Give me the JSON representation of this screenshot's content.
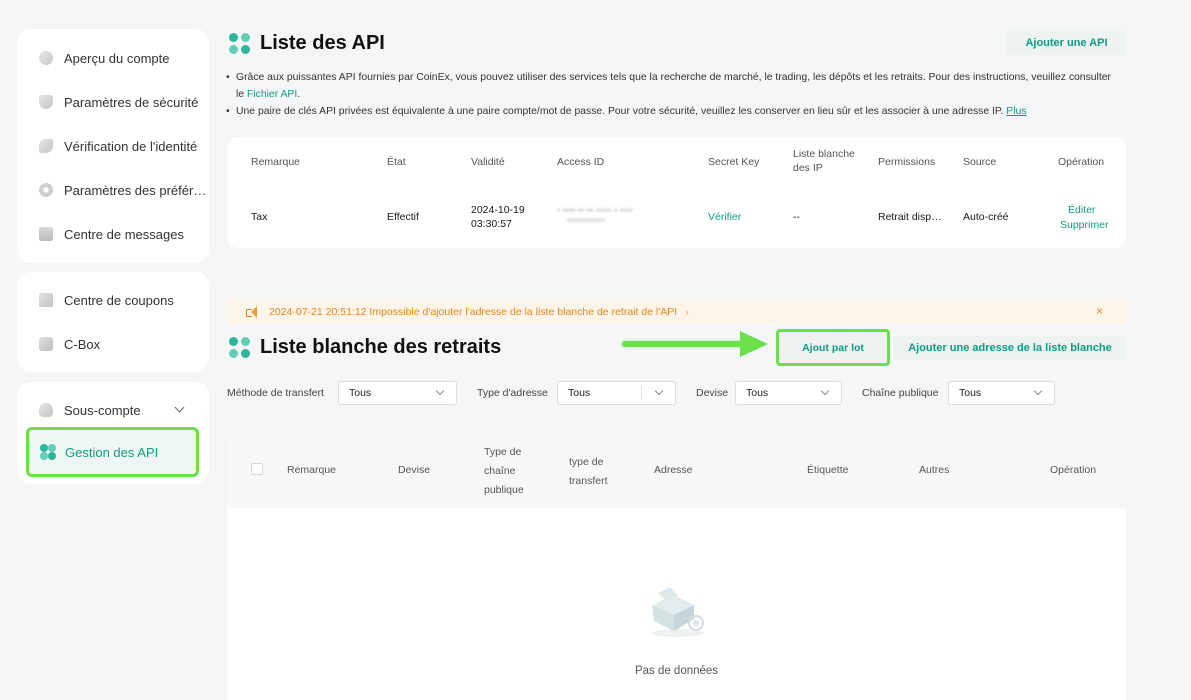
{
  "sidebar": {
    "group1": [
      {
        "label": "Aperçu du compte",
        "icon": "pie-chart-icon"
      },
      {
        "label": "Paramètres de sécurité",
        "icon": "shield-icon"
      },
      {
        "label": "Vérification de l'identité",
        "icon": "id-leaf-icon"
      },
      {
        "label": "Paramètres des préfér…",
        "icon": "gear-icon"
      },
      {
        "label": "Centre de messages",
        "icon": "message-icon"
      }
    ],
    "group2": [
      {
        "label": "Centre de coupons",
        "icon": "coupon-icon"
      },
      {
        "label": "C-Box",
        "icon": "box-icon"
      }
    ],
    "group3": [
      {
        "label": "Sous-compte",
        "icon": "sub-account-icon"
      },
      {
        "label": "Gestion des API",
        "icon": "api-icon"
      }
    ]
  },
  "api_list": {
    "title": "Liste des API",
    "add_button": "Ajouter une API",
    "bullet1_text": "Grâce aux puissantes API fournies par CoinEx, vous pouvez utiliser des services tels que la recherche de marché, le trading, les dépôts et les retraits. Pour des instructions, veuillez consulter le",
    "bullet1_link": "Fichier API",
    "bullet1_end": ".",
    "bullet2_text": "Une paire de clés API privées est équivalente à une paire compte/mot de passe. Pour votre sécurité, veuillez les conserver en lieu sûr et les associer à une adresse IP.",
    "bullet2_link": "Plus",
    "columns": {
      "remark": "Remarque",
      "state": "État",
      "validity": "Validité",
      "access_id": "Access ID",
      "secret_key": "Secret Key",
      "whitelist_ip_1": "Liste blanche",
      "whitelist_ip_2": "des IP",
      "permissions": "Permissions",
      "source": "Source",
      "operation": "Opération"
    },
    "row": {
      "remark": "Tax",
      "state": "Effectif",
      "validity_date": "2024-10-19",
      "validity_time": "03:30:57",
      "secret_key": "Vérifier",
      "whitelist_ip": "--",
      "permissions": "Retrait disp…",
      "source": "Auto-créé",
      "edit": "Éditer",
      "delete": "Supprimer"
    }
  },
  "notice": {
    "text": "2024-07-21 20:51:12  Impossible d'ajouter l'adresse de la liste blanche de retrait de l'API",
    "chevron": "›",
    "close": "×"
  },
  "whitelist": {
    "title": "Liste blanche des retraits",
    "batch_button": "Ajout par lot",
    "add_button": "Ajouter une adresse de la liste blanche",
    "filters": [
      {
        "label": "Méthode de transfert",
        "value": "Tous"
      },
      {
        "label": "Type d'adresse",
        "value": "Tous"
      },
      {
        "label": "Devise",
        "value": "Tous"
      },
      {
        "label": "Chaîne publique",
        "value": "Tous"
      }
    ],
    "columns": {
      "remark": "Remarque",
      "currency": "Devise",
      "chain_type_1": "Type de",
      "chain_type_2": "chaîne",
      "chain_type_3": "publique",
      "transfer_type_1": "type de",
      "transfer_type_2": "transfert",
      "address": "Adresse",
      "label": "Étiquette",
      "others": "Autres",
      "operation": "Opération"
    },
    "empty": "Pas de données"
  },
  "colors": {
    "accent": "#0e9c86",
    "highlight": "#6be04a",
    "notice": "#e8881a"
  }
}
